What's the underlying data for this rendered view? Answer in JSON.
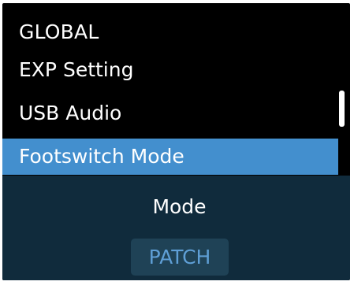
{
  "menu": {
    "title": "GLOBAL",
    "items": [
      {
        "label": "EXP Setting",
        "selected": false
      },
      {
        "label": "USB Audio",
        "selected": false
      },
      {
        "label": "Footswitch Mode",
        "selected": true
      }
    ]
  },
  "sub_panel": {
    "label": "Mode",
    "value": "PATCH"
  },
  "colors": {
    "selected_background": "#438fce",
    "panel_background": "#102b3c",
    "value_text": "#5f9fd6"
  }
}
